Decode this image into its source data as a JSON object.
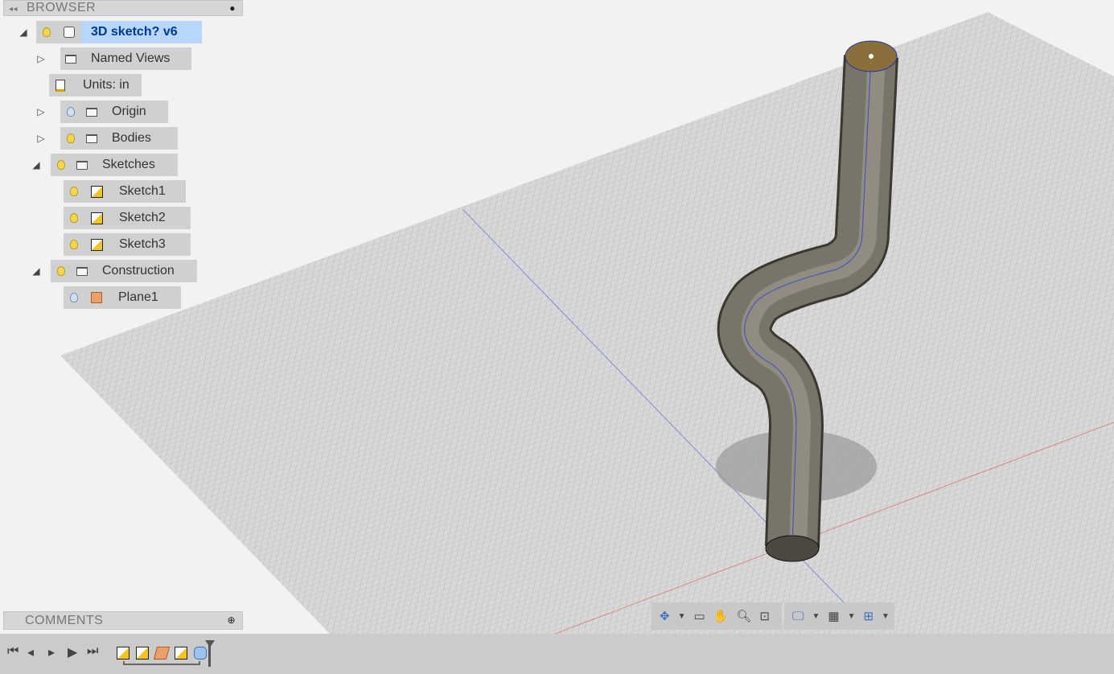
{
  "browser": {
    "title": "BROWSER",
    "root": "3D sketch? v6",
    "items": [
      {
        "label": "Named Views"
      },
      {
        "label": "Units: in"
      },
      {
        "label": "Origin"
      },
      {
        "label": "Bodies"
      },
      {
        "label": "Sketches"
      },
      {
        "label": "Sketch1"
      },
      {
        "label": "Sketch2"
      },
      {
        "label": "Sketch3"
      },
      {
        "label": "Construction"
      },
      {
        "label": "Plane1"
      }
    ]
  },
  "comments": {
    "title": "COMMENTS"
  },
  "colors": {
    "accent": "#b8d6fb",
    "root_text": "#003a8c"
  }
}
